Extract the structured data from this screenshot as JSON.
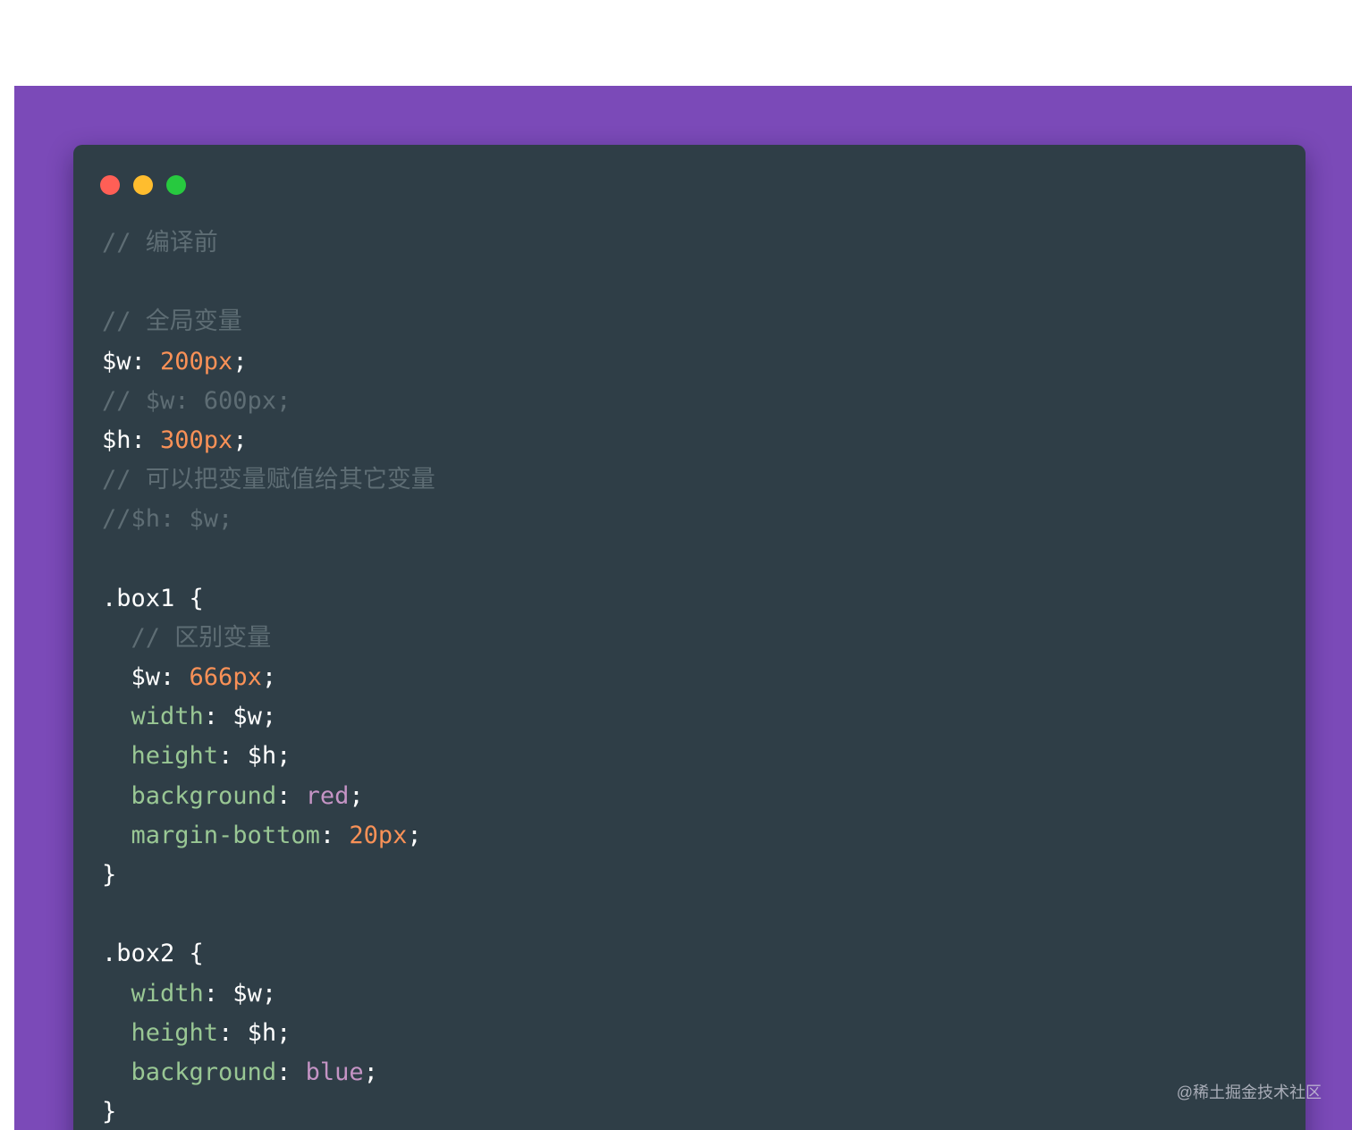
{
  "colors": {
    "background": "#7b4ab8",
    "editor": "#2f3e47",
    "comment": "#5e6d74",
    "number": "#f99157",
    "property": "#99c794",
    "keyword": "#c594c5",
    "plain": "#ffffff"
  },
  "window_buttons": [
    "close",
    "minimize",
    "maximize"
  ],
  "code": {
    "lines": [
      [
        {
          "t": "// 编译前",
          "c": "comment"
        }
      ],
      [],
      [
        {
          "t": "// 全局变量",
          "c": "comment"
        }
      ],
      [
        {
          "t": "$w: ",
          "c": "plain"
        },
        {
          "t": "200px",
          "c": "num"
        },
        {
          "t": ";",
          "c": "plain"
        }
      ],
      [
        {
          "t": "// $w: 600px;",
          "c": "comment"
        }
      ],
      [
        {
          "t": "$h: ",
          "c": "plain"
        },
        {
          "t": "300px",
          "c": "num"
        },
        {
          "t": ";",
          "c": "plain"
        }
      ],
      [
        {
          "t": "// 可以把变量赋值给其它变量",
          "c": "comment"
        }
      ],
      [
        {
          "t": "//$h: $w;",
          "c": "comment"
        }
      ],
      [],
      [
        {
          "t": ".box1 {",
          "c": "plain"
        }
      ],
      [
        {
          "t": "  // 区别变量",
          "c": "comment"
        }
      ],
      [
        {
          "t": "  $w: ",
          "c": "plain"
        },
        {
          "t": "666px",
          "c": "num"
        },
        {
          "t": ";",
          "c": "plain"
        }
      ],
      [
        {
          "t": "  ",
          "c": "plain"
        },
        {
          "t": "width",
          "c": "prop"
        },
        {
          "t": ": $w;",
          "c": "plain"
        }
      ],
      [
        {
          "t": "  ",
          "c": "plain"
        },
        {
          "t": "height",
          "c": "prop"
        },
        {
          "t": ": $h;",
          "c": "plain"
        }
      ],
      [
        {
          "t": "  ",
          "c": "plain"
        },
        {
          "t": "background",
          "c": "prop"
        },
        {
          "t": ": ",
          "c": "plain"
        },
        {
          "t": "red",
          "c": "kw"
        },
        {
          "t": ";",
          "c": "plain"
        }
      ],
      [
        {
          "t": "  ",
          "c": "plain"
        },
        {
          "t": "margin-bottom",
          "c": "prop"
        },
        {
          "t": ": ",
          "c": "plain"
        },
        {
          "t": "20px",
          "c": "num"
        },
        {
          "t": ";",
          "c": "plain"
        }
      ],
      [
        {
          "t": "}",
          "c": "plain"
        }
      ],
      [],
      [
        {
          "t": ".box2 {",
          "c": "plain"
        }
      ],
      [
        {
          "t": "  ",
          "c": "plain"
        },
        {
          "t": "width",
          "c": "prop"
        },
        {
          "t": ": $w;",
          "c": "plain"
        }
      ],
      [
        {
          "t": "  ",
          "c": "plain"
        },
        {
          "t": "height",
          "c": "prop"
        },
        {
          "t": ": $h;",
          "c": "plain"
        }
      ],
      [
        {
          "t": "  ",
          "c": "plain"
        },
        {
          "t": "background",
          "c": "prop"
        },
        {
          "t": ": ",
          "c": "plain"
        },
        {
          "t": "blue",
          "c": "kw"
        },
        {
          "t": ";",
          "c": "plain"
        }
      ],
      [
        {
          "t": "}",
          "c": "plain"
        }
      ]
    ]
  },
  "watermark": "@稀土掘金技术社区"
}
